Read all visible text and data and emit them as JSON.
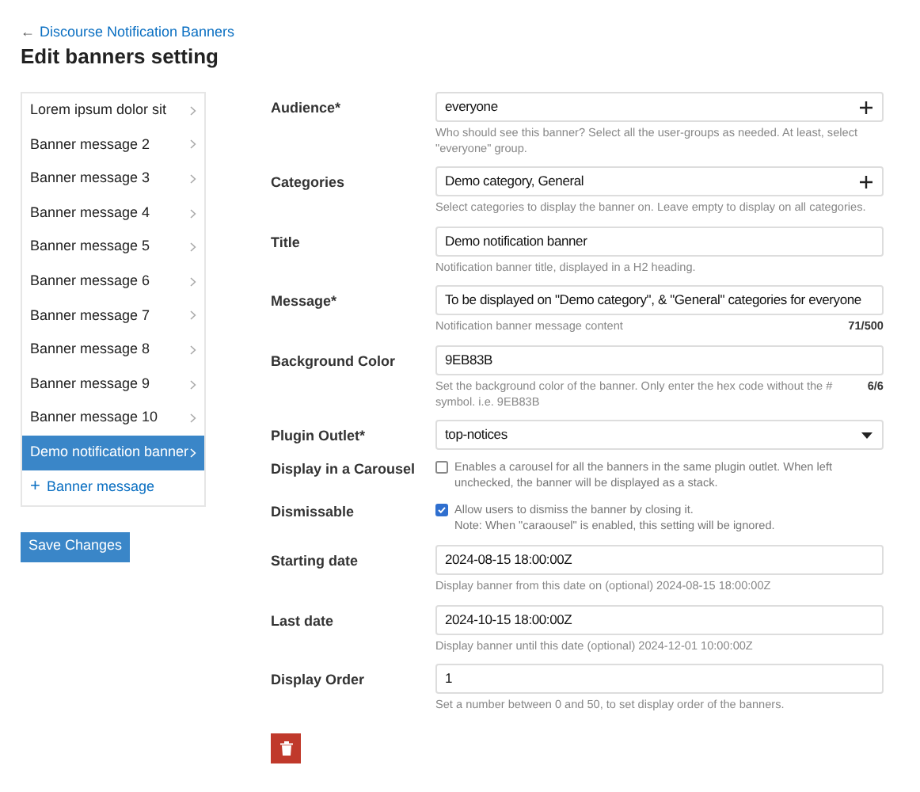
{
  "back_link": {
    "arrow": "←",
    "label": "Discourse Notification Banners"
  },
  "heading": "Edit banners setting",
  "sidebar": {
    "items": [
      {
        "label": "Lorem ipsum dolor sit",
        "selected": false
      },
      {
        "label": "Banner message 2",
        "selected": false
      },
      {
        "label": "Banner message 3",
        "selected": false
      },
      {
        "label": "Banner message 4",
        "selected": false
      },
      {
        "label": "Banner message 5",
        "selected": false
      },
      {
        "label": "Banner message 6",
        "selected": false
      },
      {
        "label": "Banner message 7",
        "selected": false
      },
      {
        "label": "Banner message 8",
        "selected": false
      },
      {
        "label": "Banner message 9",
        "selected": false
      },
      {
        "label": "Banner message 10",
        "selected": false
      },
      {
        "label": "Demo notification banner",
        "selected": true
      }
    ],
    "add_link": {
      "icon": "+",
      "label": "Banner message"
    }
  },
  "save_button": "Save Changes",
  "fields": [
    {
      "kind": "multiselect",
      "label": "Audience*",
      "value": "everyone",
      "help": "Who should see this banner? Select all the user-groups as needed. At least, select \"everyone\" group."
    },
    {
      "kind": "multiselect",
      "label": "Categories",
      "value": "Demo category, General",
      "help": "Select categories to display the banner on. Leave empty to display on all categories."
    },
    {
      "kind": "text",
      "label": "Title",
      "value": "Demo notification banner",
      "help": "Notification banner title, displayed in a H2 heading."
    },
    {
      "kind": "text",
      "label": "Message*",
      "value": "To be displayed on \"Demo category\", & \"General\" categories for everyone",
      "help": "Notification banner message content",
      "counter": "71/500"
    },
    {
      "kind": "text",
      "label": "Background Color",
      "value": "9EB83B",
      "help": "Set the background color of the banner. Only enter the hex code without the # symbol. i.e. 9EB83B",
      "counter": "6/6"
    },
    {
      "kind": "select",
      "label": "Plugin Outlet*",
      "value": "top-notices"
    },
    {
      "kind": "checkbox",
      "label": "Display in a Carousel",
      "checked": false,
      "help": "Enables a carousel for all the banners in the same plugin outlet. When left unchecked, the banner will be displayed as a stack."
    },
    {
      "kind": "checkbox",
      "label": "Dismissable",
      "checked": true,
      "help": "Allow users to dismiss the banner by closing it.",
      "note": "Note: When \"caraousel\" is enabled, this setting will be ignored."
    },
    {
      "kind": "text",
      "label": "Starting date",
      "value": "2024-08-15 18:00:00Z",
      "help": "Display banner from this date on (optional) 2024-08-15 18:00:00Z"
    },
    {
      "kind": "text",
      "label": "Last date",
      "value": "2024-10-15 18:00:00Z",
      "help": "Display banner until this date (optional) 2024-12-01 10:00:00Z"
    },
    {
      "kind": "text",
      "label": "Display Order",
      "value": "1",
      "help": "Set a number between 0 and 50, to set display order of the banners."
    }
  ]
}
